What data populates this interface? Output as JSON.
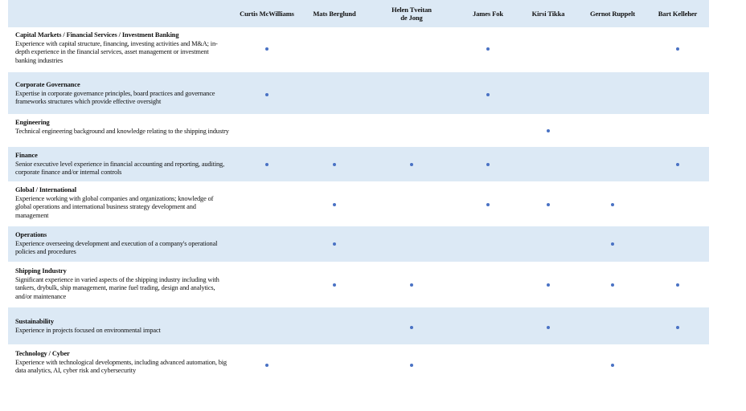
{
  "directors": [
    "Curtis McWilliams",
    "Mats Berglund",
    "Helen Tveitan\nde Jong",
    "James Fok",
    "Kirsi Tikka",
    "Gernot Ruppelt",
    "Bart Kelleher"
  ],
  "dot_color": "#4a72c4",
  "shade_color": "#dce9f5",
  "skills": [
    {
      "title": "Capital Markets / Financial Services / Investment Banking",
      "description": "Experience with capital structure, financing, investing activities and M&A; in-depth experience in the financial services, asset management or investment banking industries",
      "marks": [
        true,
        false,
        false,
        true,
        false,
        false,
        true
      ]
    },
    {
      "title": "Corporate Governance",
      "description": "Expertise in corporate governance principles, board practices and governance frameworks structures which provide effective oversight",
      "marks": [
        true,
        false,
        false,
        true,
        false,
        false,
        false
      ]
    },
    {
      "title": "Engineering",
      "description": "Technical engineering background and knowledge relating to the shipping industry",
      "marks": [
        false,
        false,
        false,
        false,
        true,
        false,
        false
      ]
    },
    {
      "title": "Finance",
      "description": "Senior executive level experience in financial accounting and reporting, auditing, corporate finance and/or internal controls",
      "marks": [
        true,
        true,
        true,
        true,
        false,
        false,
        true
      ]
    },
    {
      "title": "Global / International",
      "description": "Experience working with global companies and organizations; knowledge of global operations and international business strategy development and management",
      "marks": [
        false,
        true,
        false,
        true,
        true,
        true,
        false
      ]
    },
    {
      "title": "Operations",
      "description": "Experience overseeing development and execution of a company's operational policies and procedures",
      "marks": [
        false,
        true,
        false,
        false,
        false,
        true,
        false
      ]
    },
    {
      "title": "Shipping Industry",
      "description": "Significant experience in varied aspects of the shipping industry including with tankers, drybulk, ship management, marine fuel trading, design and analytics, and/or maintenance",
      "marks": [
        false,
        true,
        true,
        false,
        true,
        true,
        true
      ]
    },
    {
      "title": "Sustainability",
      "description": "Experience in projects focused on  environmental impact",
      "marks": [
        false,
        false,
        true,
        false,
        true,
        false,
        true
      ]
    },
    {
      "title": "Technology / Cyber",
      "description": "Experience with technological developments, including advanced automation, big data analytics, AI, cyber risk and cybersecurity",
      "marks": [
        true,
        false,
        true,
        false,
        false,
        true,
        false
      ]
    }
  ]
}
